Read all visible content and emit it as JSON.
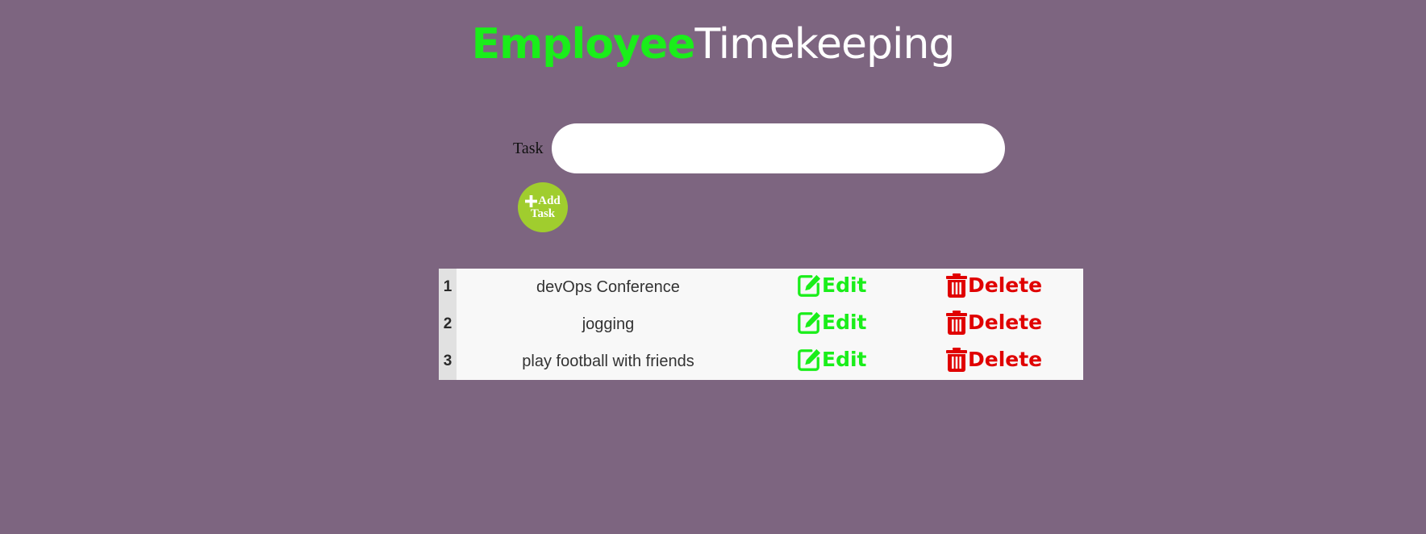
{
  "header": {
    "title_brand": "Employee",
    "title_rest": "Timekeeping"
  },
  "form": {
    "task_label": "Task",
    "task_value": "",
    "task_placeholder": "",
    "add_button_line1": "Add",
    "add_button_line2": "Task",
    "add_icon": "plus-icon"
  },
  "tasks": [
    {
      "index": "1",
      "name": "devOps Conference",
      "edit_label": "Edit",
      "delete_label": "Delete"
    },
    {
      "index": "2",
      "name": "jogging",
      "edit_label": "Edit",
      "delete_label": "Delete"
    },
    {
      "index": "3",
      "name": "play football with friends",
      "edit_label": "Edit",
      "delete_label": "Delete"
    }
  ],
  "icons": {
    "edit": "edit-icon",
    "delete": "trash-icon"
  },
  "colors": {
    "background": "#7d6580",
    "brand_green": "#1aee1a",
    "title_white": "#ffffff",
    "add_button": "#a0cd2e",
    "delete_red": "#e00000",
    "table_bg": "#f8f8f8",
    "index_bg": "#e1e1e1"
  }
}
